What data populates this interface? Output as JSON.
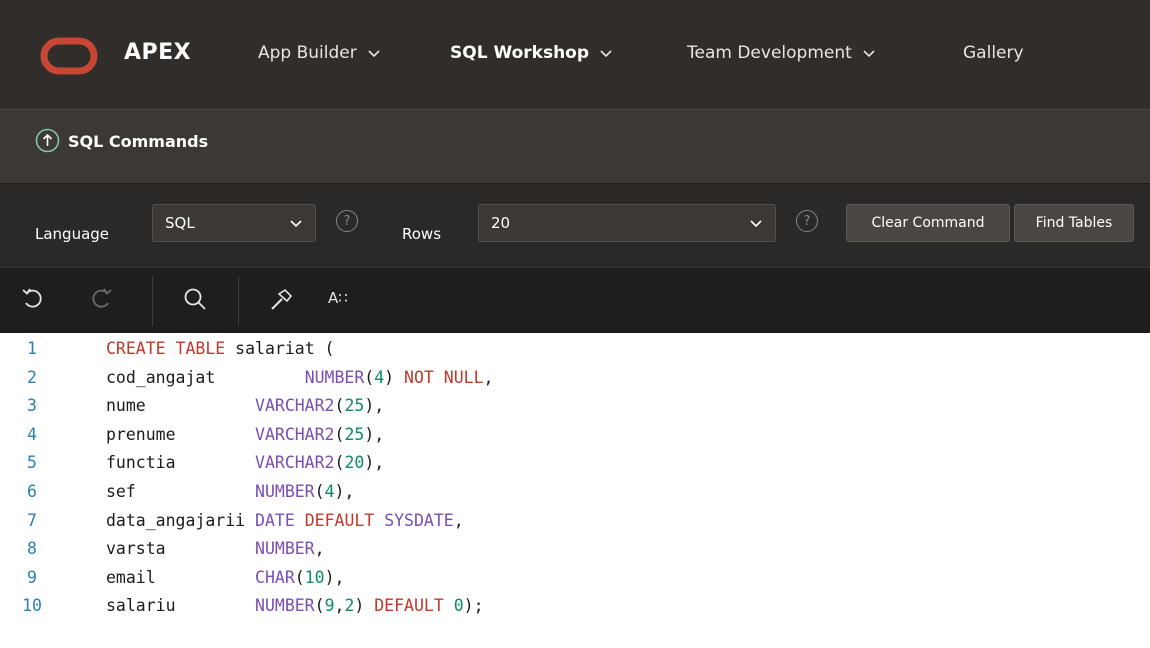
{
  "header": {
    "brand": "APEX",
    "nav": [
      {
        "label": "App Builder",
        "has_menu": true,
        "active": false
      },
      {
        "label": "SQL Workshop",
        "has_menu": true,
        "active": true
      },
      {
        "label": "Team Development",
        "has_menu": true,
        "active": false
      },
      {
        "label": "Gallery",
        "has_menu": false,
        "active": false
      }
    ]
  },
  "breadcrumb": {
    "title": "SQL Commands",
    "icon": "up-arrow-circle-icon"
  },
  "options": {
    "language_label": "Language",
    "language_value": "SQL",
    "rows_label": "Rows",
    "rows_value": "20",
    "help_glyph": "?",
    "clear_button": "Clear Command",
    "find_button": "Find Tables"
  },
  "toolbar": {
    "tools": [
      "undo-icon",
      "redo-icon",
      "search-icon",
      "hammer-icon",
      "text-format-icon"
    ],
    "format_label": "A∷"
  },
  "editor": {
    "lines": [
      {
        "n": "1",
        "tokens": [
          [
            "kw",
            "CREATE TABLE"
          ],
          [
            "pn",
            " salariat ("
          ]
        ]
      },
      {
        "n": "2",
        "tokens": [
          [
            "pn",
            "cod_angajat         "
          ],
          [
            "ty",
            "NUMBER"
          ],
          [
            "pn",
            "("
          ],
          [
            "num",
            "4"
          ],
          [
            "pn",
            ") "
          ],
          [
            "kw",
            "NOT NULL"
          ],
          [
            "pn",
            ","
          ]
        ]
      },
      {
        "n": "3",
        "tokens": [
          [
            "pn",
            "nume           "
          ],
          [
            "ty",
            "VARCHAR2"
          ],
          [
            "pn",
            "("
          ],
          [
            "num",
            "25"
          ],
          [
            "pn",
            "),"
          ]
        ]
      },
      {
        "n": "4",
        "tokens": [
          [
            "pn",
            "prenume        "
          ],
          [
            "ty",
            "VARCHAR2"
          ],
          [
            "pn",
            "("
          ],
          [
            "num",
            "25"
          ],
          [
            "pn",
            "),"
          ]
        ]
      },
      {
        "n": "5",
        "tokens": [
          [
            "pn",
            "functia        "
          ],
          [
            "ty",
            "VARCHAR2"
          ],
          [
            "pn",
            "("
          ],
          [
            "num",
            "20"
          ],
          [
            "pn",
            "),"
          ]
        ]
      },
      {
        "n": "6",
        "tokens": [
          [
            "pn",
            "sef            "
          ],
          [
            "ty",
            "NUMBER"
          ],
          [
            "pn",
            "("
          ],
          [
            "num",
            "4"
          ],
          [
            "pn",
            "),"
          ]
        ]
      },
      {
        "n": "7",
        "tokens": [
          [
            "pn",
            "data_angajarii "
          ],
          [
            "ty",
            "DATE"
          ],
          [
            "pn",
            " "
          ],
          [
            "kw",
            "DEFAULT"
          ],
          [
            "pn",
            " "
          ],
          [
            "ty",
            "SYSDATE"
          ],
          [
            "pn",
            ","
          ]
        ]
      },
      {
        "n": "8",
        "tokens": [
          [
            "pn",
            "varsta         "
          ],
          [
            "ty",
            "NUMBER"
          ],
          [
            "pn",
            ","
          ]
        ]
      },
      {
        "n": "9",
        "tokens": [
          [
            "pn",
            "email          "
          ],
          [
            "ty",
            "CHAR"
          ],
          [
            "pn",
            "("
          ],
          [
            "num",
            "10"
          ],
          [
            "pn",
            "),"
          ]
        ]
      },
      {
        "n": "10",
        "tokens": [
          [
            "pn",
            "salariu        "
          ],
          [
            "ty",
            "NUMBER"
          ],
          [
            "pn",
            "("
          ],
          [
            "num",
            "9"
          ],
          [
            "pn",
            ","
          ],
          [
            "num",
            "2"
          ],
          [
            "pn",
            ") "
          ],
          [
            "kw",
            "DEFAULT"
          ],
          [
            "pn",
            " "
          ],
          [
            "num",
            "0"
          ],
          [
            "pn",
            ");"
          ]
        ]
      }
    ]
  },
  "colors": {
    "topbar": "#312d2a",
    "logo": "#c74634",
    "keyword": "#c0392b",
    "type": "#7a4fb0",
    "number": "#0e8a6a",
    "line_number": "#2b7fb8"
  }
}
